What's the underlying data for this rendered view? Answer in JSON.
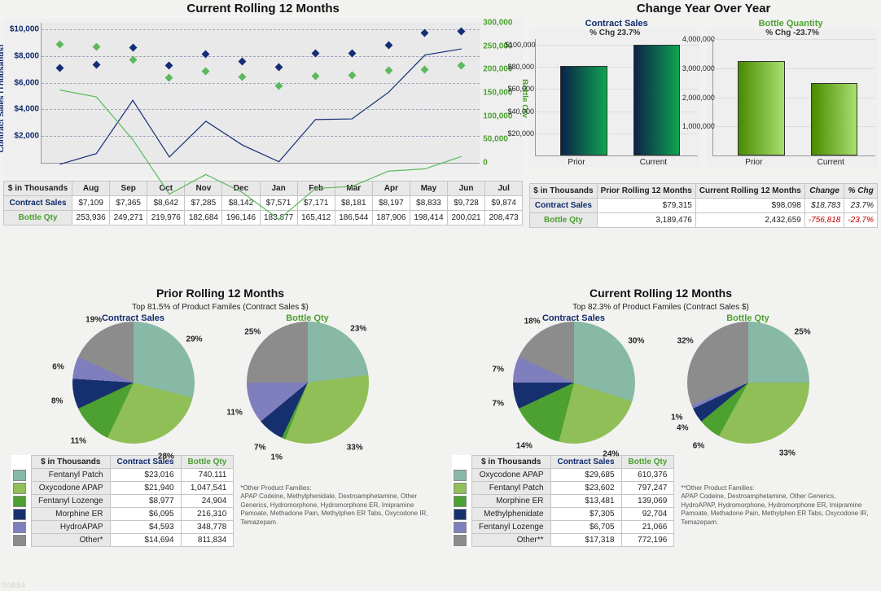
{
  "watermark": "00894",
  "chart_data": {
    "top_left_title": "Current Rolling 12 Months",
    "top_right_title": "Change Year Over Year",
    "line_chart": {
      "type": "line",
      "title": "Current Rolling 12 Months",
      "x_categories": [
        "Aug",
        "Sep",
        "Oct",
        "Nov",
        "Dec",
        "Jan",
        "Feb",
        "Mar",
        "Apr",
        "May",
        "Jun",
        "Jul"
      ],
      "y_left": {
        "label": "Contract Sales (Thousands)",
        "ticks": [
          "$2,000",
          "$4,000",
          "$6,000",
          "$8,000",
          "$10,000"
        ],
        "tick_values": [
          2000,
          4000,
          6000,
          8000,
          10000
        ],
        "range": [
          0,
          10500
        ]
      },
      "y_right": {
        "label": "Bottle Qty",
        "ticks": [
          "0",
          "50,000",
          "100,000",
          "150,000",
          "200,000",
          "250,000",
          "300,000"
        ],
        "tick_values": [
          0,
          50000,
          100000,
          150000,
          200000,
          250000,
          300000
        ],
        "range": [
          0,
          300000
        ]
      },
      "series": [
        {
          "name": "Contract Sales",
          "color": "#142d77",
          "values": [
            7109,
            7365,
            8642,
            7285,
            8142,
            7571,
            7171,
            8181,
            8197,
            8833,
            9728,
            9874
          ]
        },
        {
          "name": "Bottle Qty",
          "color": "#5cb85c",
          "values": [
            253936,
            249271,
            219976,
            182684,
            196146,
            183877,
            165412,
            186544,
            187906,
            198414,
            200021,
            208473
          ]
        }
      ]
    },
    "month_table": {
      "corner_label": "$ in Thousands",
      "row_labels": [
        "Contract Sales",
        "Bottle Qty"
      ],
      "sales": [
        "$7,109",
        "$7,365",
        "$8,642",
        "$7,285",
        "$8,142",
        "$7,571",
        "$7,171",
        "$8,181",
        "$8,197",
        "$8,833",
        "$9,728",
        "$9,874"
      ],
      "bottles": [
        "253,936",
        "249,271",
        "219,976",
        "182,684",
        "196,146",
        "183,877",
        "165,412",
        "186,544",
        "187,906",
        "198,414",
        "200,021",
        "208,473"
      ]
    },
    "yoy": {
      "contract": {
        "label": "Contract Sales",
        "pct_text": "% Chg 23.7%",
        "y_ticks": [
          "$20,000",
          "$40,000",
          "$60,000",
          "$80,000",
          "$100,000"
        ],
        "y_values": [
          20000,
          40000,
          60000,
          80000,
          100000
        ],
        "y_max": 105000,
        "prior": 79315,
        "current": 98098,
        "cat_labels": [
          "Prior",
          "Current"
        ]
      },
      "bottle": {
        "label": "Bottle Quantity",
        "pct_text": "% Chg -23.7%",
        "y_ticks": [
          "1,000,000",
          "2,000,000",
          "3,000,000",
          "4,000,000"
        ],
        "y_values": [
          1000000,
          2000000,
          3000000,
          4000000
        ],
        "y_max": 4000000,
        "prior": 3189476,
        "current": 2432659,
        "cat_labels": [
          "Prior",
          "Current"
        ]
      }
    },
    "yoy_table": {
      "corner": "$ in Thousands",
      "cols": [
        "Prior Rolling 12 Months",
        "Current Rolling 12 Months",
        "Change",
        "% Chg"
      ],
      "rows": [
        {
          "label": "Contract Sales",
          "style": "blue",
          "cells": [
            "$79,315",
            "$98,098",
            "$18,783",
            "23.7%"
          ],
          "change_neg": false
        },
        {
          "label": "Bottle Qty",
          "style": "green",
          "cells": [
            "3,189,476",
            "2,432,659",
            "-756,818",
            "-23.7%"
          ],
          "change_neg": true
        }
      ]
    },
    "palette": {
      "Fentanyl Patch": "#88b8a6",
      "Oxycodone APAP": "#8fbf56",
      "Fentanyl Lozenge": "#4ca130",
      "Morphine ER": "#16306f",
      "HydroAPAP": "#7f7fbe",
      "Methylphenidate": "#16306f",
      "Other*": "#8c8c8c",
      "Other**": "#8c8c8c"
    },
    "prior": {
      "title": "Prior Rolling 12 Months",
      "subtitle": "Top 81.5% of Product Familes (Contract Sales $)",
      "sales_pie_label": "Contract Sales",
      "qty_pie_label": "Bottle Qty",
      "sales_pie": [
        {
          "name": "Fentanyl Patch",
          "pct": 29,
          "color": "#88b8a6"
        },
        {
          "name": "Oxycodone APAP",
          "pct": 28,
          "color": "#8fbf56"
        },
        {
          "name": "Fentanyl Lozenge",
          "pct": 11,
          "color": "#4ca130"
        },
        {
          "name": "Morphine ER",
          "pct": 8,
          "color": "#16306f"
        },
        {
          "name": "HydroAPAP",
          "pct": 6,
          "color": "#7f7fbe"
        },
        {
          "name": "Other*",
          "pct": 19,
          "color": "#8c8c8c"
        }
      ],
      "qty_pie": [
        {
          "name": "Fentanyl Patch",
          "pct": 23,
          "color": "#88b8a6"
        },
        {
          "name": "Oxycodone APAP",
          "pct": 33,
          "color": "#8fbf56"
        },
        {
          "name": "Fentanyl Lozenge",
          "pct": 1,
          "color": "#4ca130"
        },
        {
          "name": "Morphine ER",
          "pct": 7,
          "color": "#16306f"
        },
        {
          "name": "HydroAPAP",
          "pct": 11,
          "color": "#7f7fbe"
        },
        {
          "name": "Other*",
          "pct": 25,
          "color": "#8c8c8c"
        }
      ],
      "table_header_unit": "$ in Thousands",
      "table_cols": [
        "Contract Sales",
        "Bottle Qty"
      ],
      "table_rows": [
        {
          "name": "Fentanyl Patch",
          "sales": "$23,016",
          "qty": "740,111",
          "color": "#88b8a6"
        },
        {
          "name": "Oxycodone APAP",
          "sales": "$21,940",
          "qty": "1,047,541",
          "color": "#8fbf56"
        },
        {
          "name": "Fentanyl Lozenge",
          "sales": "$8,977",
          "qty": "24,904",
          "color": "#4ca130"
        },
        {
          "name": "Morphine ER",
          "sales": "$6,095",
          "qty": "216,310",
          "color": "#16306f"
        },
        {
          "name": "HydroAPAP",
          "sales": "$4,593",
          "qty": "348,778",
          "color": "#7f7fbe"
        },
        {
          "name": "Other*",
          "sales": "$14,694",
          "qty": "811,834",
          "color": "#8c8c8c"
        }
      ],
      "footnote_head": "*Other Product Families:",
      "footnote_body": "APAP Codeine, Methylphenidate, Dextroamphetamine, Other Generics, Hydromorphone, Hydromorphone ER, Imipramine Pamoate, Methadone Pain, Methylphen ER Tabs, Oxycodone IR, Temazepam."
    },
    "current": {
      "title": "Current Rolling 12 Months",
      "subtitle": "Top 82.3% of Product Familes (Contract Sales $)",
      "sales_pie_label": "Contract Sales",
      "qty_pie_label": "Bottle Qty",
      "sales_pie": [
        {
          "name": "Oxycodone APAP",
          "pct": 30,
          "color": "#88b8a6"
        },
        {
          "name": "Fentanyl Patch",
          "pct": 24,
          "color": "#8fbf56"
        },
        {
          "name": "Morphine ER",
          "pct": 14,
          "color": "#4ca130"
        },
        {
          "name": "Methylphenidate",
          "pct": 7,
          "color": "#16306f"
        },
        {
          "name": "Fentanyl Lozenge",
          "pct": 7,
          "color": "#7f7fbe"
        },
        {
          "name": "Other**",
          "pct": 18,
          "color": "#8c8c8c"
        }
      ],
      "qty_pie": [
        {
          "name": "Oxycodone APAP",
          "pct": 25,
          "color": "#88b8a6"
        },
        {
          "name": "Fentanyl Patch",
          "pct": 33,
          "color": "#8fbf56"
        },
        {
          "name": "Morphine ER",
          "pct": 6,
          "color": "#4ca130"
        },
        {
          "name": "Methylphenidate",
          "pct": 4,
          "color": "#16306f"
        },
        {
          "name": "Fentanyl Lozenge",
          "pct": 1,
          "color": "#7f7fbe"
        },
        {
          "name": "Other**",
          "pct": 32,
          "color": "#8c8c8c"
        }
      ],
      "table_header_unit": "$ in Thousands",
      "table_cols": [
        "Contract Sales",
        "Bottle Qty"
      ],
      "table_rows": [
        {
          "name": "Oxycodone APAP",
          "sales": "$29,685",
          "qty": "610,376",
          "color": "#88b8a6"
        },
        {
          "name": "Fentanyl Patch",
          "sales": "$23,602",
          "qty": "797,247",
          "color": "#8fbf56"
        },
        {
          "name": "Morphine ER",
          "sales": "$13,481",
          "qty": "139,069",
          "color": "#4ca130"
        },
        {
          "name": "Methylphenidate",
          "sales": "$7,305",
          "qty": "92,704",
          "color": "#16306f"
        },
        {
          "name": "Fentanyl Lozenge",
          "sales": "$6,705",
          "qty": "21,066",
          "color": "#7f7fbe"
        },
        {
          "name": "Other**",
          "sales": "$17,318",
          "qty": "772,196",
          "color": "#8c8c8c"
        }
      ],
      "footnote_head": "**Other Product Families:",
      "footnote_body": "APAP Codeine, Dextroamphetamine, Other Generics, HydroAPAP, Hydromorphone, Hydromorphone ER, Imipramine Pamoate, Methadone Pain, Methylphen ER Tabs, Oxycodone IR, Temazepam."
    }
  }
}
